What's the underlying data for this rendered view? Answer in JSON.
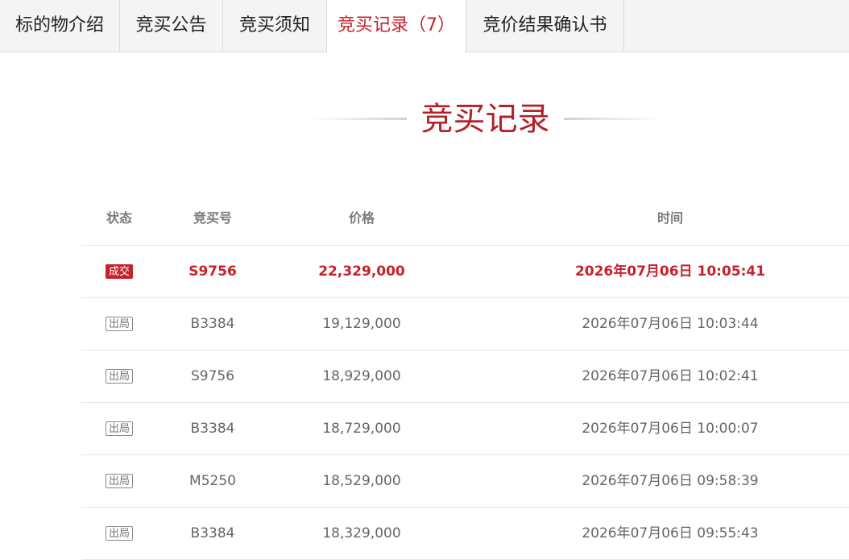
{
  "tabs": [
    {
      "label": "标的物介绍",
      "active": false
    },
    {
      "label": "竞买公告",
      "active": false
    },
    {
      "label": "竞买须知",
      "active": false
    },
    {
      "label": "竞买记录（7）",
      "active": true
    },
    {
      "label": "竞价结果确认书",
      "active": false
    }
  ],
  "section_title": "竞买记录",
  "table": {
    "headers": [
      "状态",
      "竞买号",
      "价格",
      "时间"
    ],
    "rows": [
      {
        "status": "成交",
        "bid_no": "S9756",
        "price": "22,329,000",
        "time": "2026年07月06日 10:05:41",
        "winner": true
      },
      {
        "status": "出局",
        "bid_no": "B3384",
        "price": "19,129,000",
        "time": "2026年07月06日 10:03:44",
        "winner": false
      },
      {
        "status": "出局",
        "bid_no": "S9756",
        "price": "18,929,000",
        "time": "2026年07月06日 10:02:41",
        "winner": false
      },
      {
        "status": "出局",
        "bid_no": "B3384",
        "price": "18,729,000",
        "time": "2026年07月06日 10:00:07",
        "winner": false
      },
      {
        "status": "出局",
        "bid_no": "M5250",
        "price": "18,529,000",
        "time": "2026年07月06日 09:58:39",
        "winner": false
      },
      {
        "status": "出局",
        "bid_no": "B3384",
        "price": "18,329,000",
        "time": "2026年07月06日 09:55:43",
        "winner": false
      }
    ]
  },
  "colors": {
    "accent": "#c4222c",
    "title": "#b3212b"
  }
}
